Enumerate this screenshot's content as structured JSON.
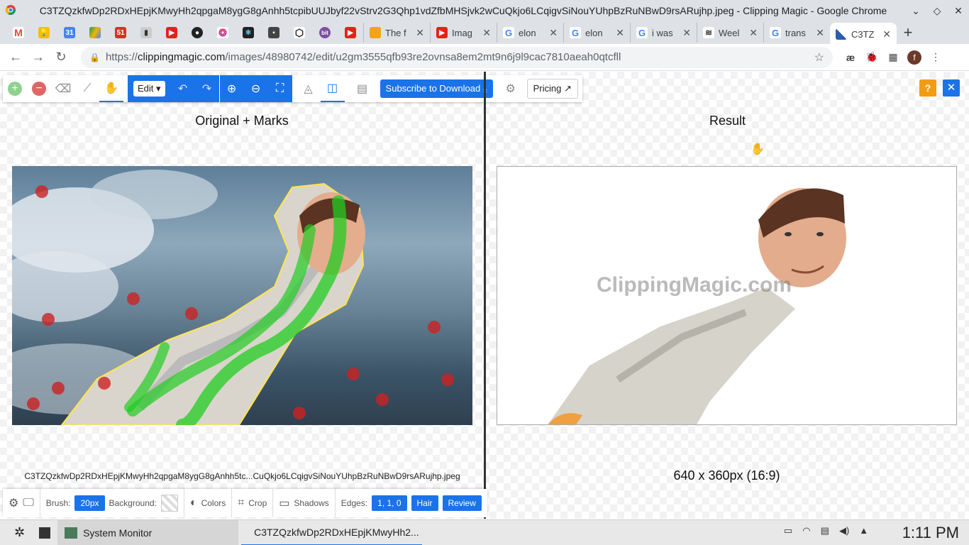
{
  "window": {
    "title": "C3TZQzkfwDp2RDxHEpjKMwyHh2qpgaM8ygG8gAnhh5tcpibUUJbyf22vStrv2G3Qhp1vdZfbMHSjvk2wCuQkjo6LCqigvSiNouYUhpBzRuNBwD9rsARujhp.jpeg - Clipping Magic - Google Chrome"
  },
  "tabs": [
    {
      "label": "The f",
      "color": "#f4a21a"
    },
    {
      "label": "Imag",
      "color": "#e62117"
    },
    {
      "label": "elon",
      "color": "#4285f4"
    },
    {
      "label": "elon",
      "color": "#4285f4"
    },
    {
      "label": "i was",
      "color": "#4285f4"
    },
    {
      "label": "Weel",
      "color": "#333333"
    },
    {
      "label": "trans",
      "color": "#4285f4"
    },
    {
      "label": "C3TZ",
      "color": "#2a5db0"
    }
  ],
  "address": {
    "prefix": "https://",
    "host": "clippingmagic.com",
    "path": "/images/48980742/edit/u2gm3555qfb93re2ovnsa8em2mt9n6j9l9cac7810aeah0qtcfll"
  },
  "toolbar": {
    "edit_label": "Edit",
    "subscribe_label": "Subscribe to Download",
    "pricing_label": "Pricing",
    "help_label": "?"
  },
  "panels": {
    "left_title": "Original + Marks",
    "right_title": "Result",
    "filename": "C3TZQzkfwDp2RDxHEpjKMwyHh2qpgaM8ygG8gAnhh5tc...CuQkjo6LCqigvSiNouYUhpBzRuNBwD9rsARujhp.jpeg",
    "dimensions": "640 x 360px (16:9)",
    "watermark": "ClippingMagic.com"
  },
  "bottom": {
    "brush_label": "Brush:",
    "brush_value": "20px",
    "background_label": "Background:",
    "colors_label": "Colors",
    "crop_label": "Crop",
    "shadows_label": "Shadows",
    "edges_label": "Edges:",
    "edges_value": "1, 1, 0",
    "hair_label": "Hair",
    "review_label": "Review"
  },
  "taskbar": {
    "system_monitor": "System Monitor",
    "chrome_window": "C3TZQzkfwDp2RDxHEpjKMwyHh2...",
    "clock": "1:11 PM"
  }
}
